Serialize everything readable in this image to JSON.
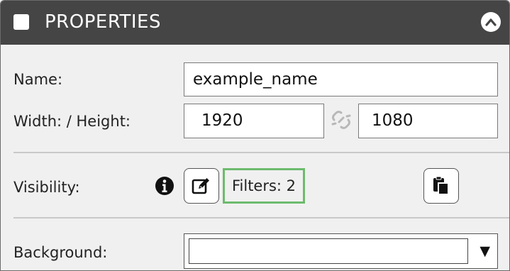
{
  "header": {
    "title": "PROPERTIES",
    "checkbox_checked": false,
    "collapse_icon": "chevron-up-icon"
  },
  "fields": {
    "name_label": "Name:",
    "name_value": "example_name",
    "size_label": "Width: / Height:",
    "width_value": "1920",
    "height_value": "1080",
    "link_icon": "unlink-icon",
    "visibility_label": "Visibility:",
    "info_icon": "info-icon",
    "edit_icon": "edit-icon",
    "filters_label": "Filters: 2",
    "paste_icon": "paste-icon",
    "background_label": "Background:",
    "background_value": ""
  },
  "colors": {
    "header_bg": "#454545",
    "panel_bg": "#f0f0f0",
    "filters_border": "#6dbb6d"
  }
}
